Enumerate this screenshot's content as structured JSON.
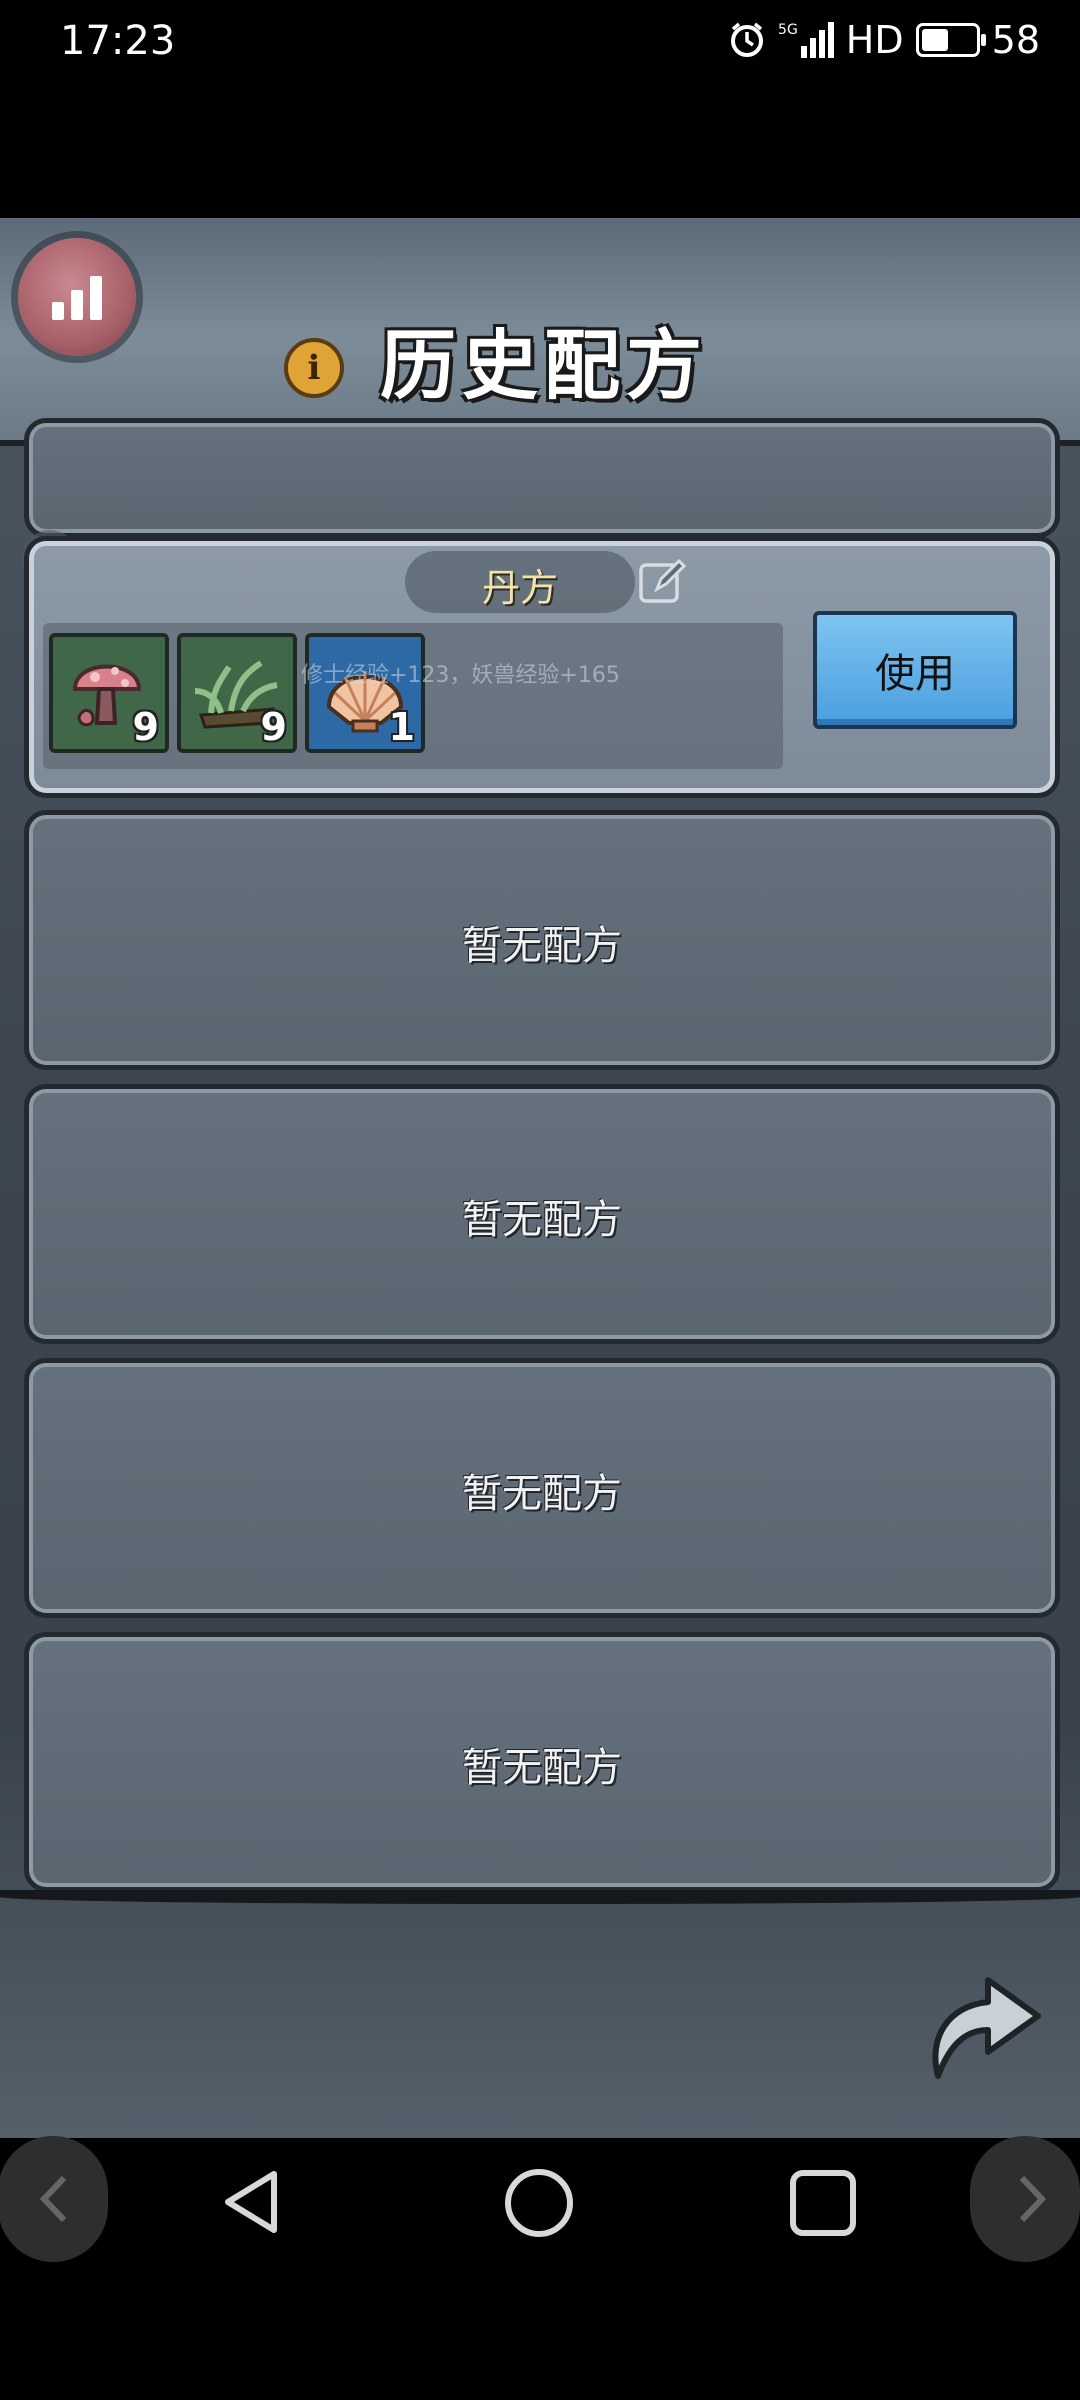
{
  "status_bar": {
    "time": "17:23",
    "network_label": "5G",
    "hd_label": "HD",
    "battery_level": "58",
    "icons": [
      "alarm-icon",
      "signal-icon",
      "battery-icon"
    ]
  },
  "header": {
    "title": "历史配方",
    "icons": [
      "stats-icon",
      "info-icon"
    ]
  },
  "recipes": {
    "saved": {
      "name": "丹方",
      "effect_text": "修士经验+123，妖兽经验+165",
      "use_label": "使用",
      "ingredients": [
        {
          "icon": "mushroom-icon",
          "quantity": "9"
        },
        {
          "icon": "herb-icon",
          "quantity": "9"
        },
        {
          "icon": "shell-icon",
          "quantity": "1"
        }
      ]
    },
    "empty_label": "暂无配方",
    "empty_count": 4
  },
  "colors": {
    "use_button": "#4a9ee0",
    "recipe_name": "#f4e3a8",
    "info_icon": "#e0a336",
    "stats_button": "#a85f67"
  },
  "navigation": [
    "back-icon",
    "home-icon",
    "recents-icon"
  ]
}
